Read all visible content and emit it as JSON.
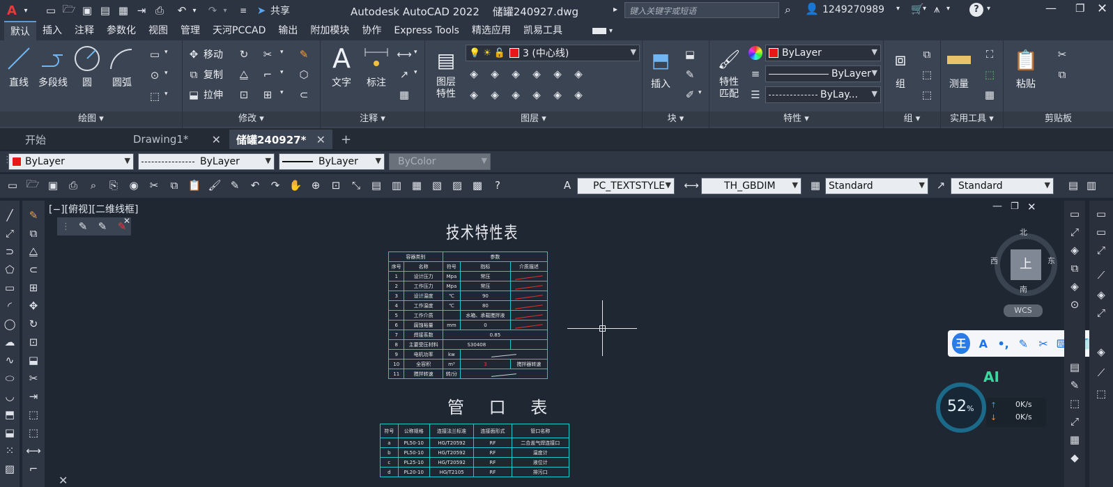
{
  "app": {
    "title": "Autodesk AutoCAD 2022",
    "file": "储罐240927.dwg",
    "share": "共享",
    "search_placeholder": "键入关键字或短语",
    "user": "1249270989"
  },
  "ribbon_tabs": [
    "默认",
    "插入",
    "注释",
    "参数化",
    "视图",
    "管理",
    "天河PCCAD",
    "输出",
    "附加模块",
    "协作",
    "Express Tools",
    "精选应用",
    "凯易工具"
  ],
  "ribbon": {
    "draw": {
      "title": "绘图 ▾",
      "line": "直线",
      "polyline": "多段线",
      "circle": "圆",
      "arc": "圆弧"
    },
    "modify": {
      "title": "修改 ▾",
      "move": "移动",
      "copy": "复制",
      "stretch": "拉伸"
    },
    "annotation": {
      "title": "注释 ▾",
      "text": "文字",
      "dim": "标注"
    },
    "layers": {
      "title": "图层 ▾",
      "props": "图层\n特性",
      "current": "3 (中心线)"
    },
    "block": {
      "title": "块 ▾",
      "insert": "插入"
    },
    "properties": {
      "title": "特性 ▾",
      "match": "特性\n匹配",
      "color": "ByLayer",
      "linetype": "ByLayer",
      "lineweight": "ByLay..."
    },
    "groups": {
      "title": "组 ▾",
      "group": "组"
    },
    "utilities": {
      "title": "实用工具 ▾",
      "measure": "测量"
    },
    "clipboard": {
      "title": "剪贴板",
      "paste": "粘贴"
    }
  },
  "doc_tabs": [
    {
      "label": "开始"
    },
    {
      "label": "Drawing1*"
    },
    {
      "label": "储罐240927*"
    }
  ],
  "props_bar": {
    "color": "ByLayer",
    "linetype": "ByLayer",
    "lineweight": "ByLayer",
    "plotstyle": "ByColor"
  },
  "styles_bar": {
    "textstyle": "PC_TEXTSTYLE",
    "dimstyle": "TH_GBDIM",
    "tablestyle": "Standard",
    "mleader": "Standard"
  },
  "viewport": {
    "label": "[−][俯视][二维线框]"
  },
  "viewcube": {
    "top": "上",
    "n": "北",
    "s": "南",
    "e": "东",
    "w": "西",
    "wcs": "WCS"
  },
  "perf": {
    "pct": "52",
    "unit": "%",
    "up": "0K/s",
    "down": "0K/s",
    "ai": "AI"
  },
  "float_toolbar": {
    "logo": "王",
    "a": "A"
  },
  "tech_table": {
    "title": "技术特性表",
    "header1": [
      "容器类别",
      "参数"
    ],
    "header2": [
      "序号",
      "名称",
      "符号",
      "指标",
      "介质描述"
    ],
    "rows": [
      [
        "1",
        "设计压力",
        "Mpa",
        "常压",
        ""
      ],
      [
        "2",
        "工作压力",
        "Mpa",
        "常压",
        ""
      ],
      [
        "3",
        "设计温度",
        "℃",
        "90",
        ""
      ],
      [
        "4",
        "工作温度",
        "℃",
        "80",
        ""
      ],
      [
        "5",
        "工作介质",
        "",
        "水箱、承载搅拌液",
        ""
      ],
      [
        "6",
        "腐蚀裕量",
        "mm",
        "0",
        ""
      ],
      [
        "7",
        "焊接系数",
        "",
        "0.85",
        ""
      ],
      [
        "8",
        "主要受压材料",
        "",
        "S30408",
        ""
      ],
      [
        "9",
        "电机功率",
        "kw",
        "",
        ""
      ],
      [
        "10",
        "全容积",
        "m³",
        "3",
        "搅拌器转速"
      ],
      [
        "11",
        "搅拌转速",
        "转/分",
        "",
        ""
      ]
    ]
  },
  "nozzle_table": {
    "title": "管 口 表",
    "header": [
      "符号",
      "公称规格",
      "连接法兰标准",
      "连接面形式",
      "管口名称"
    ],
    "rows": [
      [
        "a",
        "PL50-10",
        "HG/T20592",
        "RF",
        "二合盖气焊连接口"
      ],
      [
        "b",
        "PL50-10",
        "HG/T20592",
        "RF",
        "温度计"
      ],
      [
        "c",
        "PL25-10",
        "HG/T20592",
        "RF",
        "液位计"
      ],
      [
        "d",
        "PL20-10",
        "HG/T2105",
        "RF",
        "排污口"
      ]
    ]
  }
}
